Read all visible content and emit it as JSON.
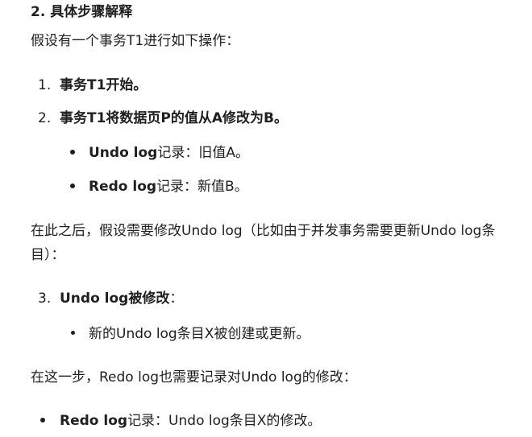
{
  "heading": "2. 具体步骤解释",
  "intro": "假设有一个事务T1进行如下操作：",
  "steps": [
    {
      "number": "1.",
      "text": "事务T1开始。"
    },
    {
      "number": "2.",
      "text": "事务T1将数据页P的值从A修改为B。"
    }
  ],
  "step2_bullets": [
    {
      "bold": "Undo log",
      "text": "记录：旧值A。"
    },
    {
      "bold": "Redo log",
      "text": "记录：新值B。"
    }
  ],
  "paragraph2_line1": "在此之后，假设需要修改Undo log（比如由于并发事务需要更新Undo log条",
  "paragraph2_line2": "目）：",
  "step3": {
    "number": "3.",
    "bold": "Undo log被修改",
    "text": "："
  },
  "step3_bullet": "新的Undo log条目X被创建或更新。",
  "paragraph3": "在这一步，Redo log也需要记录对Undo log的修改：",
  "final_bullet": {
    "bold": "Redo log",
    "text": "记录：Undo log条目X的修改。"
  }
}
